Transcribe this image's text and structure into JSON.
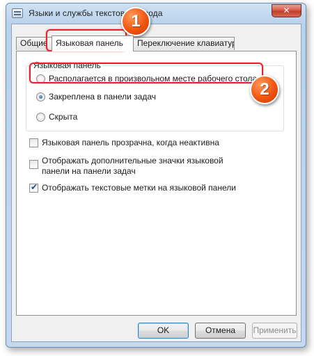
{
  "window": {
    "title": "Языки и службы текстового ввода",
    "close_label": "✕"
  },
  "tabs": [
    {
      "label": "Общие"
    },
    {
      "label": "Языковая панель"
    },
    {
      "label": "Переключение клавиатуры"
    }
  ],
  "language_bar_group": {
    "label": "Языковая панель",
    "options": [
      {
        "label": "Располагается в произвольном месте рабочего стола",
        "selected": false
      },
      {
        "label": "Закреплена в панели задач",
        "selected": true
      },
      {
        "label": "Скрыта",
        "selected": false
      }
    ]
  },
  "checkboxes": [
    {
      "label": "Языковая панель прозрачна, когда неактивна",
      "checked": false
    },
    {
      "label": "Отображать дополнительные значки языковой панели на панели задач",
      "checked": false
    },
    {
      "label": "Отображать текстовые метки на языковой панели",
      "checked": true
    }
  ],
  "buttons": {
    "ok": "OK",
    "cancel": "Отмена",
    "apply": "Применить"
  },
  "annotations": {
    "step1": "1",
    "step2": "2",
    "highlight_color": "#e3242b",
    "badge_color": "#f25410"
  }
}
